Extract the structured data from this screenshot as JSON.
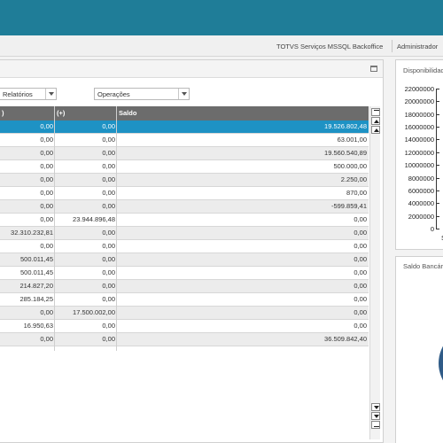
{
  "header": {
    "environment": "TOTVS Serviços MSSQL Backoffice",
    "user": "Administrador"
  },
  "filters": {
    "reports_select": "Relatórios",
    "operations_select": "Operações"
  },
  "grid": {
    "columns": [
      ")",
      "(+)",
      "Saldo"
    ],
    "rows": [
      [
        "0,00",
        "0,00",
        "19.526.802,48"
      ],
      [
        "0,00",
        "0,00",
        "63.001,00"
      ],
      [
        "0,00",
        "0,00",
        "19.560.540,89"
      ],
      [
        "0,00",
        "0,00",
        "500.000,00"
      ],
      [
        "0,00",
        "0,00",
        "2.250,00"
      ],
      [
        "0,00",
        "0,00",
        "870,00"
      ],
      [
        "0,00",
        "0,00",
        "-599.859,41"
      ],
      [
        "0,00",
        "23.944.896,48",
        "0,00"
      ],
      [
        "32.310.232,81",
        "0,00",
        "0,00"
      ],
      [
        "0,00",
        "0,00",
        "0,00"
      ],
      [
        "500.011,45",
        "0,00",
        "0,00"
      ],
      [
        "500.011,45",
        "0,00",
        "0,00"
      ],
      [
        "214.827,20",
        "0,00",
        "0,00"
      ],
      [
        "285.184,25",
        "0,00",
        "0,00"
      ],
      [
        "0,00",
        "17.500.002,00",
        "0,00"
      ],
      [
        "16.950,63",
        "0,00",
        "0,00"
      ],
      [
        "0,00",
        "0,00",
        "36.509.842,40"
      ]
    ]
  },
  "side_panels": {
    "availability_title": "Disponibilidad",
    "balance_title": "Saldo Bancár"
  },
  "chart_data": {
    "type": "bar",
    "title": "Disponibilidad",
    "y_ticks": [
      "22000000",
      "20000000",
      "18000000",
      "16000000",
      "14000000",
      "12000000",
      "10000000",
      "8000000",
      "6000000",
      "4000000",
      "2000000",
      "0"
    ],
    "ylim": [
      0,
      22000000
    ],
    "categories": [
      "S"
    ]
  },
  "colors": {
    "topbar": "#1f7d98",
    "selected_row": "#1e92c4",
    "grid_header": "#6c6c6c",
    "pie": "#2f5b87"
  }
}
